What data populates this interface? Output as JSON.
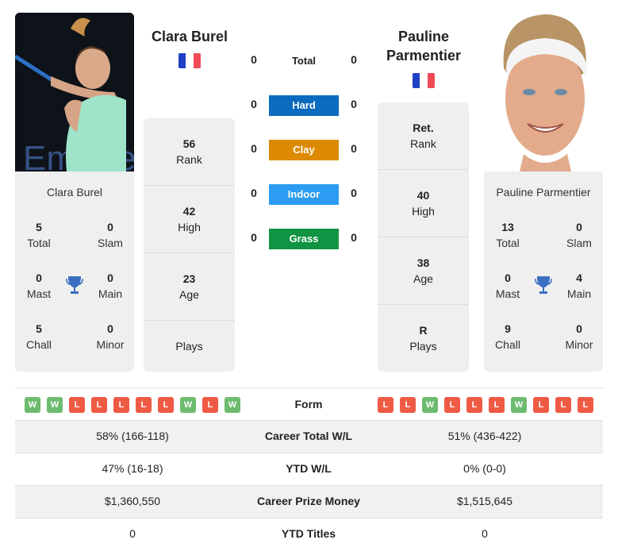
{
  "player1": {
    "name": "Clara Burel",
    "country_flag": "France",
    "photo_alt": "Clara Burel photo",
    "titles": {
      "total": "5",
      "slam": "0",
      "mast": "0",
      "main": "0",
      "chall": "5",
      "minor": "0"
    },
    "rank": "56",
    "high": "42",
    "age": "23",
    "plays": ""
  },
  "player2": {
    "name_line1": "Pauline",
    "name_line2": "Parmentier",
    "name": "Pauline Parmentier",
    "country_flag": "France",
    "photo_alt": "Pauline Parmentier photo",
    "titles": {
      "total": "13",
      "slam": "0",
      "mast": "0",
      "main": "4",
      "chall": "9",
      "minor": "0"
    },
    "rank": "Ret.",
    "high": "40",
    "age": "38",
    "plays": "R"
  },
  "labels": {
    "total": "Total",
    "slam": "Slam",
    "mast": "Mast",
    "main": "Main",
    "chall": "Chall",
    "minor": "Minor",
    "rank": "Rank",
    "high": "High",
    "age": "Age",
    "plays": "Plays"
  },
  "h2h": [
    {
      "surface": "Total",
      "p1": "0",
      "p2": "0",
      "color": ""
    },
    {
      "surface": "Hard",
      "p1": "0",
      "p2": "0",
      "color": "#0a6bbf"
    },
    {
      "surface": "Clay",
      "p1": "0",
      "p2": "0",
      "color": "#dd8a00"
    },
    {
      "surface": "Indoor",
      "p1": "0",
      "p2": "0",
      "color": "#2b9cf2"
    },
    {
      "surface": "Grass",
      "p1": "0",
      "p2": "0",
      "color": "#109342"
    }
  ],
  "form": {
    "label": "Form",
    "p1": [
      "W",
      "W",
      "L",
      "L",
      "L",
      "L",
      "L",
      "W",
      "L",
      "W"
    ],
    "p2": [
      "L",
      "L",
      "W",
      "L",
      "L",
      "L",
      "W",
      "L",
      "L",
      "L"
    ]
  },
  "comparison": [
    {
      "label": "Career Total W/L",
      "p1": "58% (166-118)",
      "p2": "51% (436-422)"
    },
    {
      "label": "YTD W/L",
      "p1": "47% (16-18)",
      "p2": "0% (0-0)"
    },
    {
      "label": "Career Prize Money",
      "p1": "$1,360,550",
      "p2": "$1,515,645"
    },
    {
      "label": "YTD Titles",
      "p1": "0",
      "p2": "0"
    }
  ],
  "icons": {
    "trophy": "trophy-icon",
    "flag": "france-flag-icon"
  },
  "colors": {
    "win": "#6dbb6f",
    "loss": "#ef5a45",
    "trophy": "#3b6fc0"
  }
}
